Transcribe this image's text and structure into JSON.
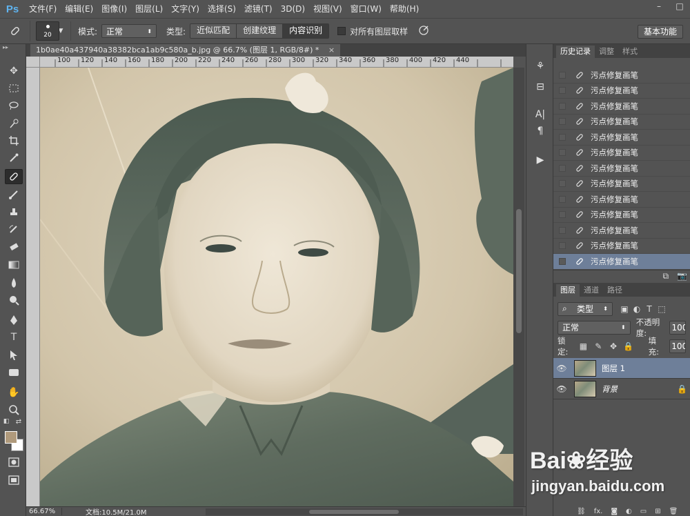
{
  "app": {
    "logo": "Ps"
  },
  "menu": [
    "文件(F)",
    "编辑(E)",
    "图像(I)",
    "图层(L)",
    "文字(Y)",
    "选择(S)",
    "滤镜(T)",
    "3D(D)",
    "视图(V)",
    "窗口(W)",
    "帮助(H)"
  ],
  "window_controls": [
    "–",
    "□"
  ],
  "options": {
    "brush_size": "20",
    "mode_label": "模式:",
    "mode_value": "正常",
    "type_label": "类型:",
    "type_options": [
      "近似匹配",
      "创建纹理",
      "内容识别"
    ],
    "type_selected": "内容识别",
    "sample_all_label": "对所有图层取样",
    "workspace": "基本功能"
  },
  "document": {
    "tab_title": "1b0ae40a437940a38382bca1ab9c580a_b.jpg @ 66.7% (图层 1, RGB/8#) *",
    "close": "×",
    "ruler_ticks": [
      "100",
      "120",
      "140",
      "160",
      "180",
      "200",
      "220",
      "240",
      "260",
      "280",
      "300",
      "320",
      "340",
      "360",
      "380",
      "400",
      "420",
      "440"
    ]
  },
  "status": {
    "zoom": "66.67%",
    "doc_info": "文档:10.5M/21.0M"
  },
  "history_panel": {
    "tabs": [
      "历史记录",
      "调整",
      "样式"
    ],
    "items": [
      "污点修复画笔",
      "污点修复画笔",
      "污点修复画笔",
      "污点修复画笔",
      "污点修复画笔",
      "污点修复画笔",
      "污点修复画笔",
      "污点修复画笔",
      "污点修复画笔",
      "污点修复画笔",
      "污点修复画笔",
      "污点修复画笔",
      "污点修复画笔"
    ]
  },
  "layers_panel": {
    "tabs": [
      "图层",
      "通道",
      "路径"
    ],
    "filter_label": "类型",
    "blend_mode": "正常",
    "opacity_label": "不透明度:",
    "opacity_value": "100",
    "lock_label": "锁定:",
    "fill_label": "填充:",
    "fill_value": "100",
    "layers": [
      {
        "name": "图层 1",
        "selected": true
      },
      {
        "name": "背景",
        "selected": false
      }
    ],
    "footer_fx": "fx."
  },
  "watermark": {
    "brand": "Bai",
    "brand2": "经验",
    "url": "jingyan.baidu.com"
  },
  "colors": {
    "accent": "#6e7f99",
    "ps_blue": "#5fb4f0",
    "fg_color": "#b09a7c"
  }
}
